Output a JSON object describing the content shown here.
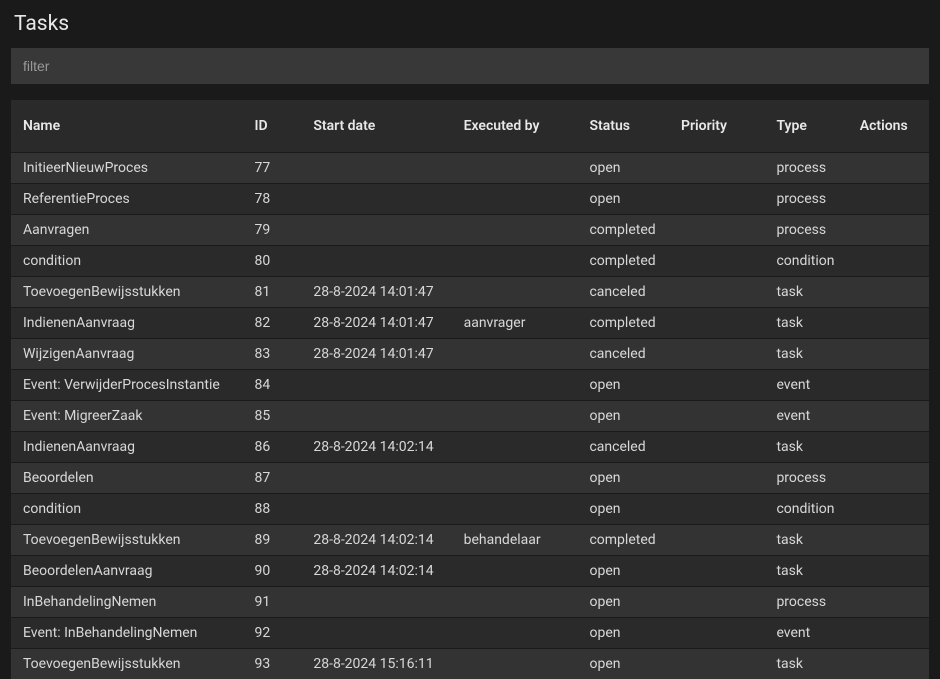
{
  "page": {
    "title": "Tasks"
  },
  "filter": {
    "placeholder": "filter",
    "value": ""
  },
  "table": {
    "headers": {
      "name": "Name",
      "id": "ID",
      "startdate": "Start date",
      "executedby": "Executed by",
      "status": "Status",
      "priority": "Priority",
      "type": "Type",
      "actions": "Actions"
    },
    "rows": [
      {
        "name": "InitieerNieuwProces",
        "id": "77",
        "startdate": "",
        "executedby": "",
        "status": "open",
        "priority": "",
        "type": "process"
      },
      {
        "name": "ReferentieProces",
        "id": "78",
        "startdate": "",
        "executedby": "",
        "status": "open",
        "priority": "",
        "type": "process"
      },
      {
        "name": "Aanvragen",
        "id": "79",
        "startdate": "",
        "executedby": "",
        "status": "completed",
        "priority": "",
        "type": "process"
      },
      {
        "name": "condition",
        "id": "80",
        "startdate": "",
        "executedby": "",
        "status": "completed",
        "priority": "",
        "type": "condition"
      },
      {
        "name": "ToevoegenBewijsstukken",
        "id": "81",
        "startdate": "28-8-2024 14:01:47",
        "executedby": "",
        "status": "canceled",
        "priority": "",
        "type": "task"
      },
      {
        "name": "IndienenAanvraag",
        "id": "82",
        "startdate": "28-8-2024 14:01:47",
        "executedby": "aanvrager",
        "status": "completed",
        "priority": "",
        "type": "task"
      },
      {
        "name": "WijzigenAanvraag",
        "id": "83",
        "startdate": "28-8-2024 14:01:47",
        "executedby": "",
        "status": "canceled",
        "priority": "",
        "type": "task"
      },
      {
        "name": "Event: VerwijderProcesInstantie",
        "id": "84",
        "startdate": "",
        "executedby": "",
        "status": "open",
        "priority": "",
        "type": "event"
      },
      {
        "name": "Event: MigreerZaak",
        "id": "85",
        "startdate": "",
        "executedby": "",
        "status": "open",
        "priority": "",
        "type": "event"
      },
      {
        "name": "IndienenAanvraag",
        "id": "86",
        "startdate": "28-8-2024 14:02:14",
        "executedby": "",
        "status": "canceled",
        "priority": "",
        "type": "task"
      },
      {
        "name": "Beoordelen",
        "id": "87",
        "startdate": "",
        "executedby": "",
        "status": "open",
        "priority": "",
        "type": "process"
      },
      {
        "name": "condition",
        "id": "88",
        "startdate": "",
        "executedby": "",
        "status": "open",
        "priority": "",
        "type": "condition"
      },
      {
        "name": "ToevoegenBewijsstukken",
        "id": "89",
        "startdate": "28-8-2024 14:02:14",
        "executedby": "behandelaar",
        "status": "completed",
        "priority": "",
        "type": "task"
      },
      {
        "name": "BeoordelenAanvraag",
        "id": "90",
        "startdate": "28-8-2024 14:02:14",
        "executedby": "",
        "status": "open",
        "priority": "",
        "type": "task"
      },
      {
        "name": "InBehandelingNemen",
        "id": "91",
        "startdate": "",
        "executedby": "",
        "status": "open",
        "priority": "",
        "type": "process"
      },
      {
        "name": "Event: InBehandelingNemen",
        "id": "92",
        "startdate": "",
        "executedby": "",
        "status": "open",
        "priority": "",
        "type": "event"
      },
      {
        "name": "ToevoegenBewijsstukken",
        "id": "93",
        "startdate": "28-8-2024 15:16:11",
        "executedby": "",
        "status": "open",
        "priority": "",
        "type": "task"
      }
    ]
  }
}
